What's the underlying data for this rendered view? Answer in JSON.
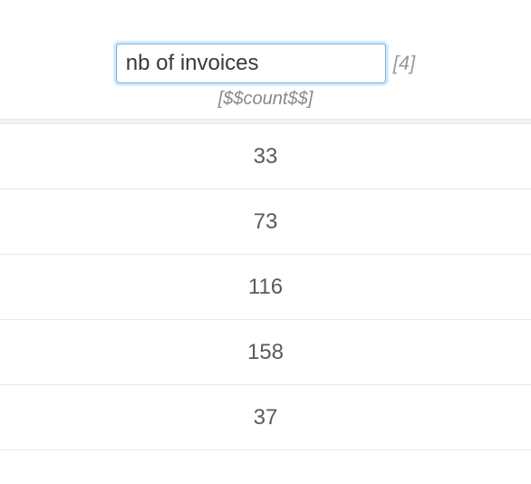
{
  "header": {
    "title_value": "nb of invoices",
    "index_tag": "[4]",
    "sub_tag": "[$$count$$]"
  },
  "rows": [
    {
      "value": "33"
    },
    {
      "value": "73"
    },
    {
      "value": "116"
    },
    {
      "value": "158"
    },
    {
      "value": "37"
    }
  ]
}
